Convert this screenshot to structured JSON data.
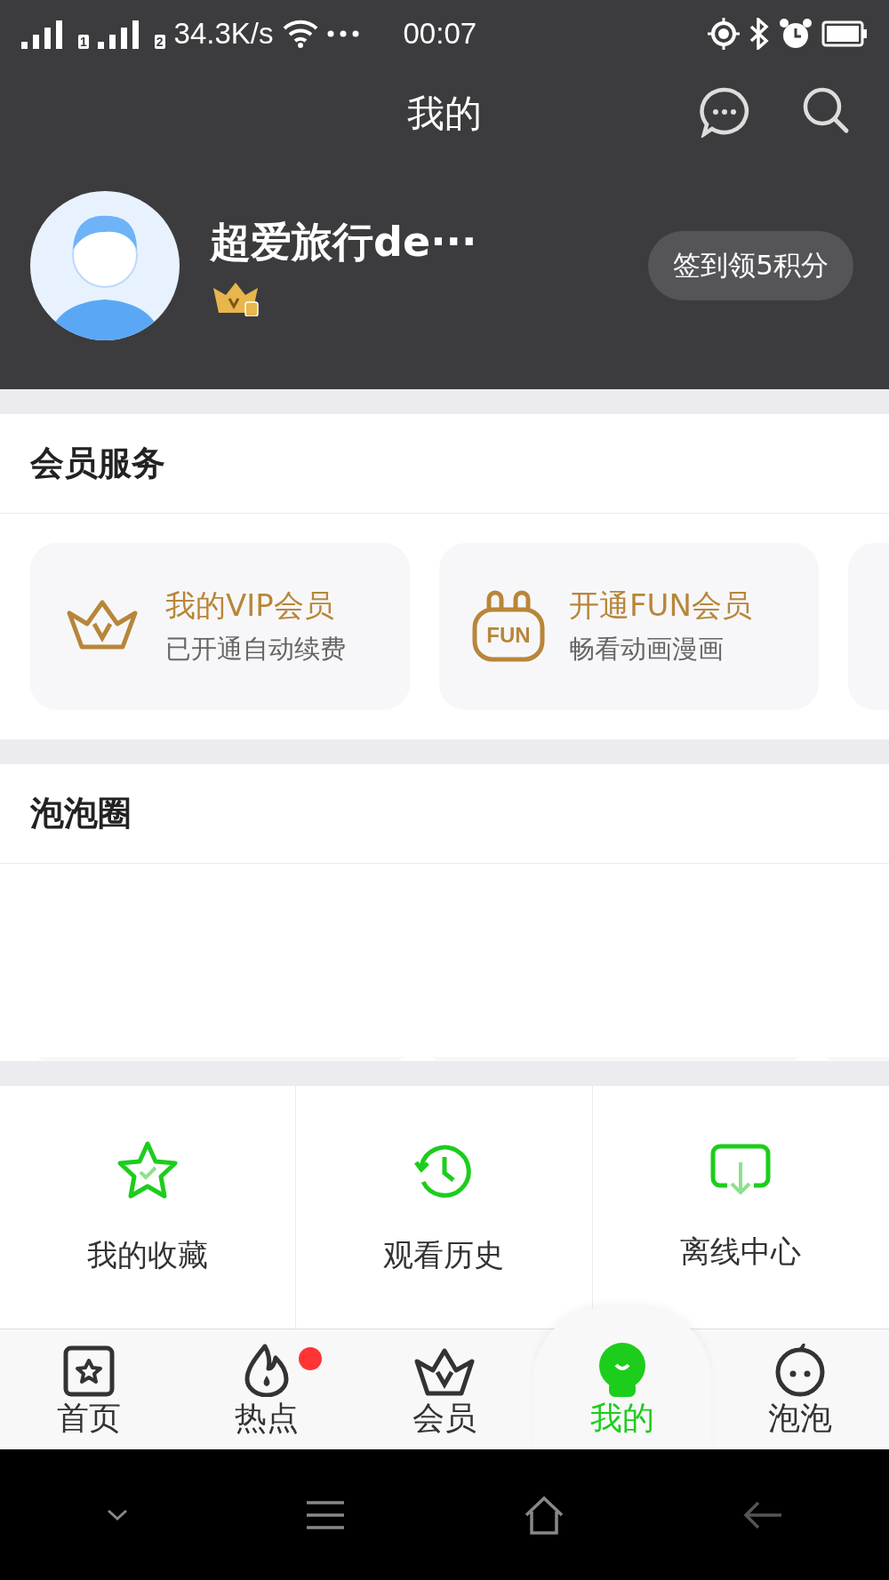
{
  "status_bar": {
    "sim_labels": [
      "1",
      "2"
    ],
    "speed": "34.3K/s",
    "time": "00:07"
  },
  "header": {
    "title": "我的"
  },
  "profile": {
    "name": "超爱旅行de···",
    "checkin_button": "签到领5积分"
  },
  "member_services": {
    "title": "会员服务",
    "cards": [
      {
        "kind": "vip",
        "title": "我的VIP会员",
        "subtitle": "已开通自动续费"
      },
      {
        "kind": "fun",
        "title": "开通FUN会员",
        "subtitle": "畅看动画漫画",
        "icon_text": "FUN"
      }
    ]
  },
  "bubble_circle": {
    "title": "泡泡圈"
  },
  "shortcuts": [
    {
      "kind": "favorites",
      "label": "我的收藏"
    },
    {
      "kind": "history",
      "label": "观看历史"
    },
    {
      "kind": "offline",
      "label": "离线中心"
    }
  ],
  "tabs": [
    {
      "kind": "home",
      "label": "首页",
      "selected": false,
      "dot": false
    },
    {
      "kind": "hot",
      "label": "热点",
      "selected": false,
      "dot": true
    },
    {
      "kind": "vip",
      "label": "会员",
      "selected": false,
      "dot": false
    },
    {
      "kind": "me",
      "label": "我的",
      "selected": true,
      "dot": false
    },
    {
      "kind": "bubble",
      "label": "泡泡",
      "selected": false,
      "dot": false
    }
  ]
}
